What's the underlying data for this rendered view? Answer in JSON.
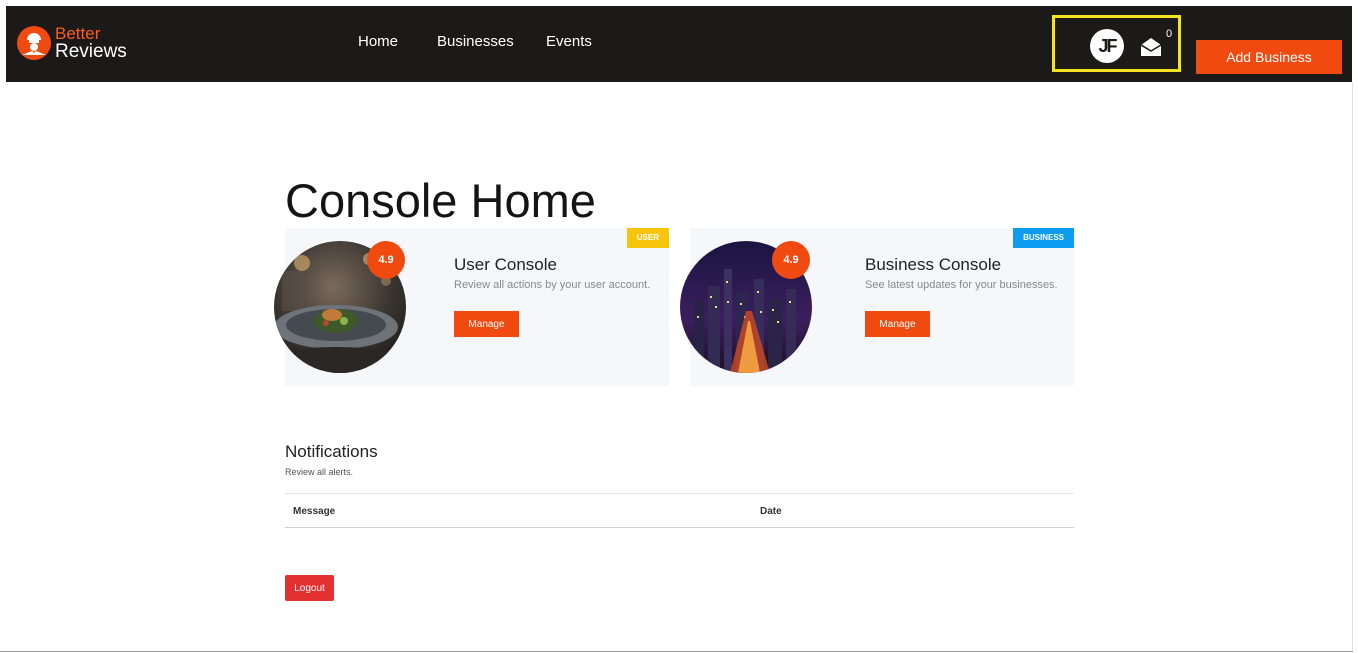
{
  "brand": {
    "line1": "Better",
    "line2": "Reviews",
    "accent": "#ff5a1f"
  },
  "nav": {
    "links": [
      {
        "label": "Home"
      },
      {
        "label": "Businesses"
      },
      {
        "label": "Events"
      }
    ]
  },
  "user": {
    "initials": "JF",
    "mail_count": "0"
  },
  "header": {
    "add_business_label": "Add Business"
  },
  "page": {
    "title": "Console Home"
  },
  "cards": [
    {
      "badge": "USER",
      "rating": "4.9",
      "title": "User Console",
      "description": "Review all actions by your user account.",
      "button": "Manage",
      "image": "plated-dish-photo"
    },
    {
      "badge": "BUSINESS",
      "rating": "4.9",
      "title": "Business Console",
      "description": "See latest updates for your businesses.",
      "button": "Manage",
      "image": "city-night-photo"
    }
  ],
  "notifications": {
    "title": "Notifications",
    "subtitle": "Review all alerts.",
    "columns": [
      "Message",
      "Date"
    ],
    "rows": []
  },
  "footer": {
    "logout_label": "Logout"
  },
  "colors": {
    "navbar_bg": "#1c1a19",
    "primary": "#f04a10",
    "user_badge": "#f7c50c",
    "business_badge": "#0d9cf0",
    "logout": "#e33131",
    "highlight": "#f2e220"
  }
}
